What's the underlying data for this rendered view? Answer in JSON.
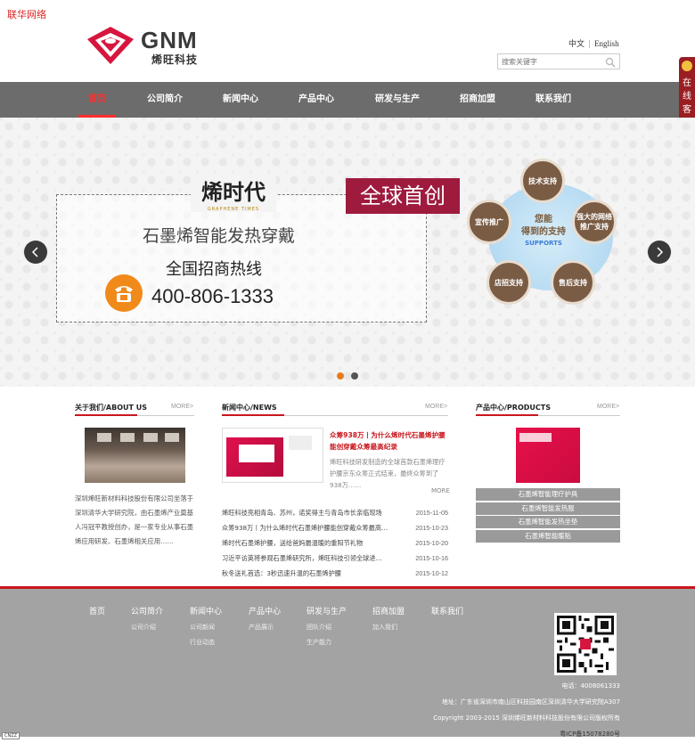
{
  "corner_tag": "联华网络",
  "brand": {
    "logo_text": "GNM",
    "logo_sub": "烯旺科技"
  },
  "lang": {
    "zh": "中文",
    "en": "English"
  },
  "search": {
    "placeholder": "搜索关键字"
  },
  "nav": {
    "items": [
      "首页",
      "公司简介",
      "新闻中心",
      "产品中心",
      "研发与生产",
      "招商加盟",
      "联系我们"
    ]
  },
  "side_service": {
    "label": "在线客服"
  },
  "banner": {
    "brand_cn": "烯时代",
    "brand_en": "GRAPHENE TIMES",
    "badge": "全球首创",
    "product_line": "石墨烯智能发热穿戴",
    "hotline_label": "全国招商热线",
    "phone": "400-806-1333",
    "support_center_1": "您能",
    "support_center_2": "得到的支持",
    "support_center_3": "SUPPORTS",
    "supports": [
      "技术支持",
      "强大的网络推广支持",
      "售后支持",
      "店招支持",
      "宣传推广"
    ],
    "slide_active_color": "#e87b1e",
    "slide_dot_color": "#555555"
  },
  "about": {
    "title": "关于我们/ABOUT US",
    "more": "MORE>",
    "text": "深圳烯旺新材料科技股份有限公司坐落于深圳清华大学研究院，由石墨烯产业奠基人冯冠平教授创办，是一家专业从事石墨烯应用研发、石墨烯相关应用……"
  },
  "news": {
    "title": "新闻中心/NEWS",
    "more": "MORE>",
    "headline": "众筹938万丨为什么烯时代石墨烯护腰能创穿戴众筹最高纪录",
    "summary": "烯旺科技研发制造的全球首款石墨烯理疗护腰京东众筹正式结束，最终众筹到了938万……",
    "detail_more": "MORE",
    "items": [
      {
        "title": "烯旺科技亮相青岛、苏州，诺奖得主与青岛市长亲临现场",
        "date": "2015-11-05"
      },
      {
        "title": "众筹938万丨为什么烯时代石墨烯护腰能创穿戴众筹最高…",
        "date": "2015-10-23"
      },
      {
        "title": "烯时代石墨烯护腰，送给爸妈最温暖的重阳节礼物",
        "date": "2015-10-20"
      },
      {
        "title": "习近平访英将参观石墨烯研究所，烯旺科技引领全球进…",
        "date": "2015-10-16"
      },
      {
        "title": "秋冬送礼首选：3秒迅速升温的石墨烯护腰",
        "date": "2015-10-12"
      }
    ]
  },
  "products": {
    "title": "产品中心/PRODUCTS",
    "more": "MORE>",
    "items": [
      "石墨烯智能理疗护具",
      "石墨烯智能发热服",
      "石墨烯智能发热坐垫",
      "石墨烯智能暖贴"
    ]
  },
  "footer": {
    "columns": [
      {
        "title": "首页",
        "subs": []
      },
      {
        "title": "公司简介",
        "subs": [
          "公司介绍"
        ]
      },
      {
        "title": "新闻中心",
        "subs": [
          "公司新闻",
          "行业动态"
        ]
      },
      {
        "title": "产品中心",
        "subs": [
          "产品展示"
        ]
      },
      {
        "title": "研发与生产",
        "subs": [
          "团队介绍",
          "生产能力"
        ]
      },
      {
        "title": "招商加盟",
        "subs": [
          "加入我们"
        ]
      },
      {
        "title": "联系我们",
        "subs": []
      }
    ],
    "phone": "电话：4008061333",
    "address": "地址：广东省深圳市南山区科技园南区深圳清华大学研究院A307",
    "copyright": "Copyright 2003-2015 深圳烯旺新材料科技股份有限公司版权所有",
    "icp": "粤ICP备15078280号",
    "cnzz": "CNZZ"
  }
}
